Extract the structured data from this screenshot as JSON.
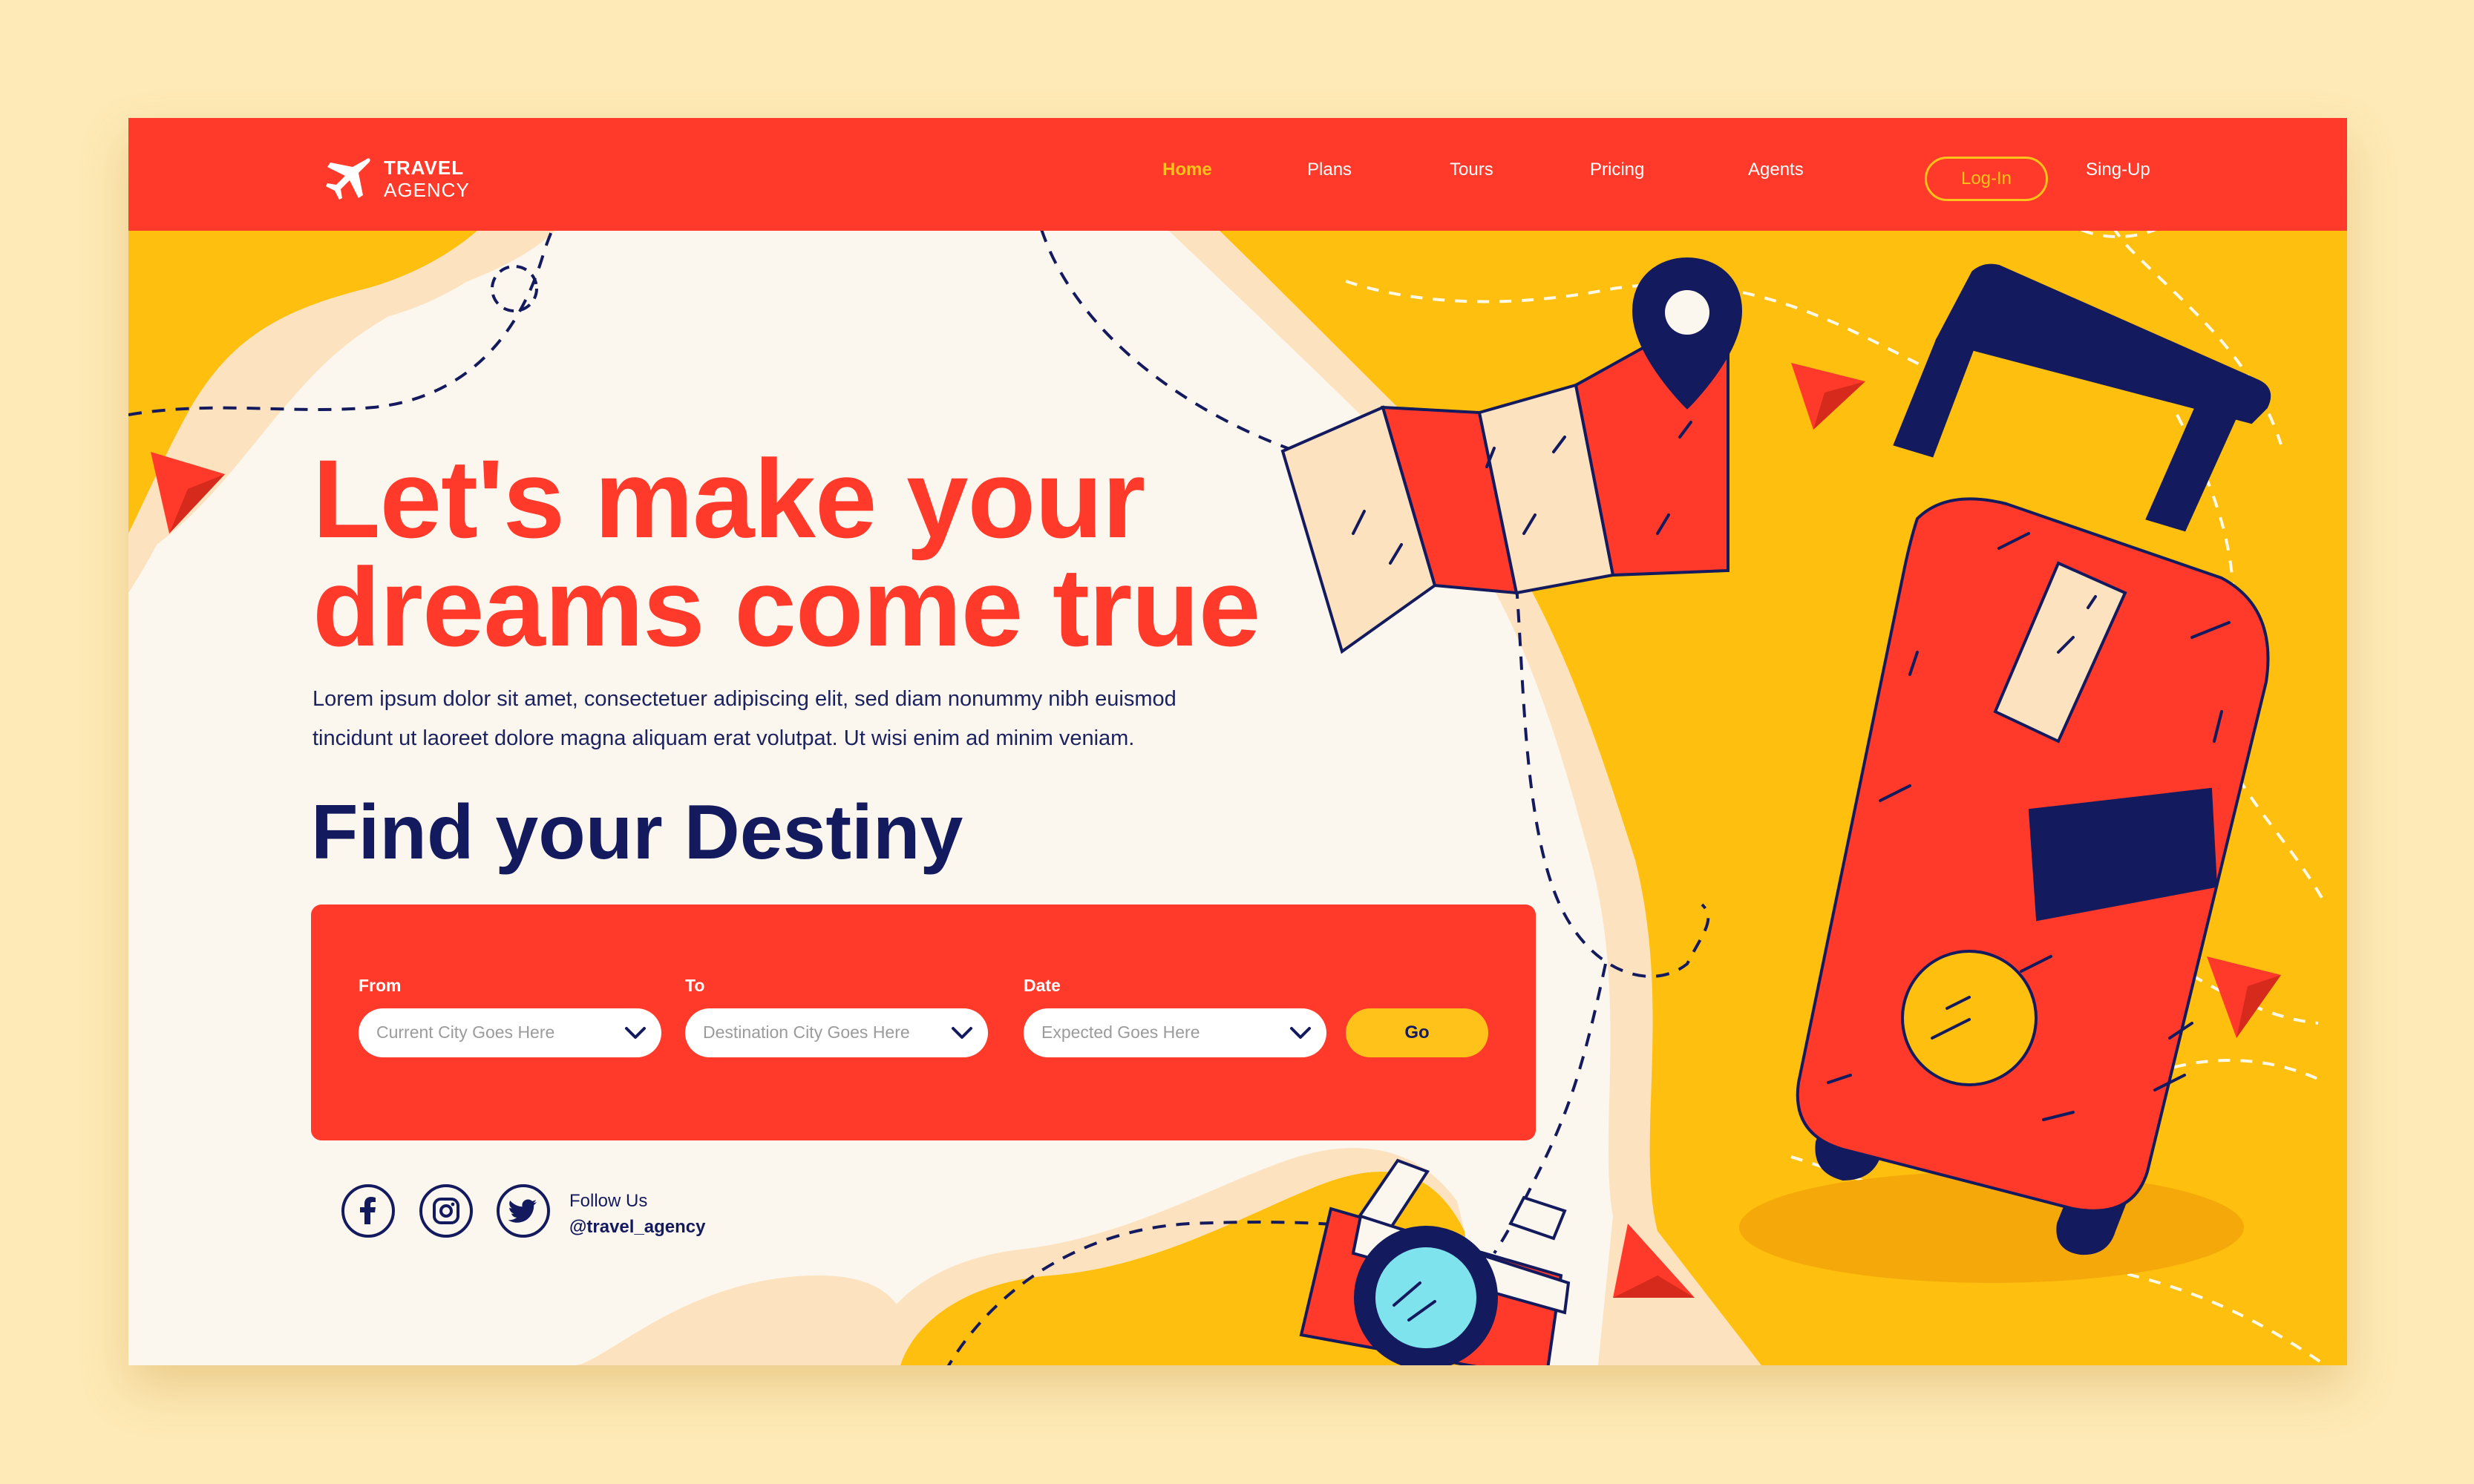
{
  "brand": {
    "name_line1": "TRAVEL",
    "name_line2": "AGENCY"
  },
  "nav": {
    "items": [
      {
        "label": "Home",
        "active": true
      },
      {
        "label": "Plans",
        "active": false
      },
      {
        "label": "Tours",
        "active": false
      },
      {
        "label": "Pricing",
        "active": false
      },
      {
        "label": "Agents",
        "active": false
      }
    ],
    "login_label": "Log-In",
    "signup_label": "Sing-Up"
  },
  "hero": {
    "title_line1": "Let's make your",
    "title_line2": "dreams come true",
    "desc_line1": "Lorem ipsum dolor sit amet, consectetuer adipiscing elit, sed diam nonummy nibh euismod",
    "desc_line2": "tincidunt ut laoreet dolore magna aliquam erat volutpat. Ut wisi enim ad minim veniam."
  },
  "search": {
    "heading": "Find your Destiny",
    "from_label": "From",
    "from_placeholder": "Current City Goes Here",
    "to_label": "To",
    "to_placeholder": "Destination City Goes Here",
    "date_label": "Date",
    "date_placeholder": "Expected Goes Here",
    "go_label": "Go"
  },
  "social": {
    "icons": [
      "facebook-icon",
      "instagram-icon",
      "twitter-icon"
    ],
    "follow_label": "Follow Us",
    "handle": "@travel_agency"
  },
  "colors": {
    "page_bg": "#FEEAB6",
    "red": "#FF3A2A",
    "yellow": "#FFBF0E",
    "cream": "#FCF7EE",
    "navy": "#131A5E"
  }
}
